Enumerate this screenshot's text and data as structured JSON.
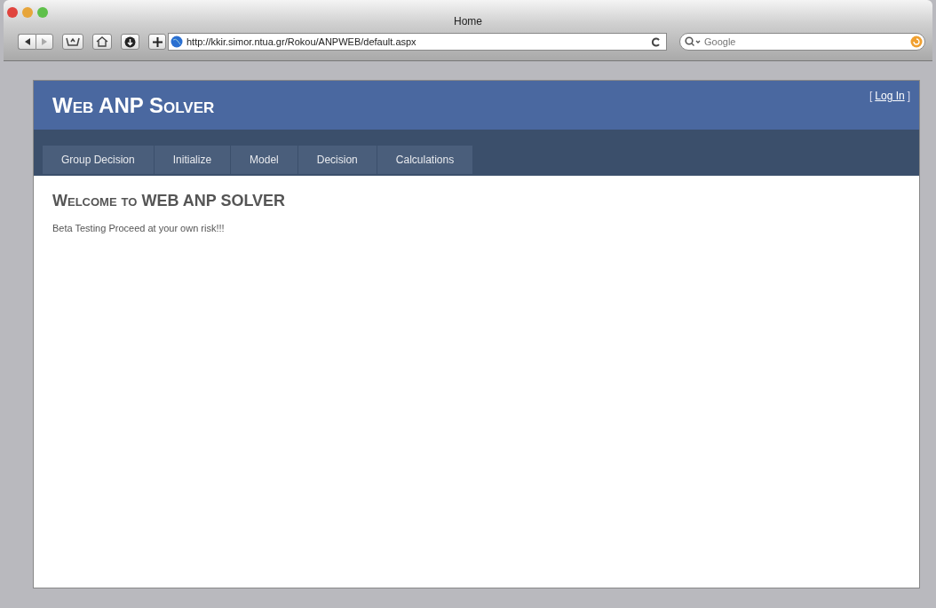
{
  "window": {
    "title": "Home"
  },
  "toolbar": {
    "address": "http://kkir.simor.ntua.gr/Rokou/ANPWEB/default.aspx",
    "search_placeholder": "Google"
  },
  "site": {
    "title": "Web ANP Solver",
    "login": {
      "open": "[",
      "link": "Log In",
      "close": "]"
    }
  },
  "tabs": [
    {
      "label": "Group Decision"
    },
    {
      "label": "Initialize"
    },
    {
      "label": "Model"
    },
    {
      "label": "Decision"
    },
    {
      "label": "Calculations"
    }
  ],
  "content": {
    "heading": "Welcome to WEB ANP SOLVER",
    "text": "Beta Testing Proceed at your own risk!!!"
  }
}
